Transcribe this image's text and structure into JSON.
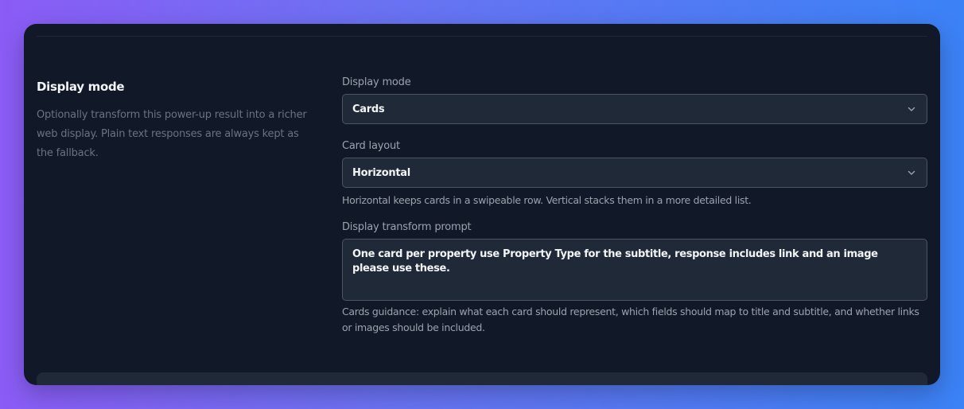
{
  "section": {
    "title": "Display mode",
    "description": "Optionally transform this power-up result into a richer web display. Plain text responses are always kept as the fallback."
  },
  "display_mode": {
    "label": "Display mode",
    "value": "Cards",
    "icon": "chevron-down-icon"
  },
  "card_layout": {
    "label": "Card layout",
    "value": "Horizontal",
    "icon": "chevron-down-icon",
    "helper": "Horizontal keeps cards in a swipeable row. Vertical stacks them in a more detailed list."
  },
  "transform_prompt": {
    "label": "Display transform prompt",
    "value": "One card per property use Property Type for the subtitle, response includes link and an image please use these.",
    "helper": "Cards guidance: explain what each card should represent, which fields should map to title and subtitle, and whether links or images should be included."
  },
  "colors": {
    "panel_bg": "#111827",
    "input_bg": "#1f2937",
    "input_border": "#4b5563",
    "gradient_start": "#8b5cf6",
    "gradient_end": "#3b82f6"
  }
}
